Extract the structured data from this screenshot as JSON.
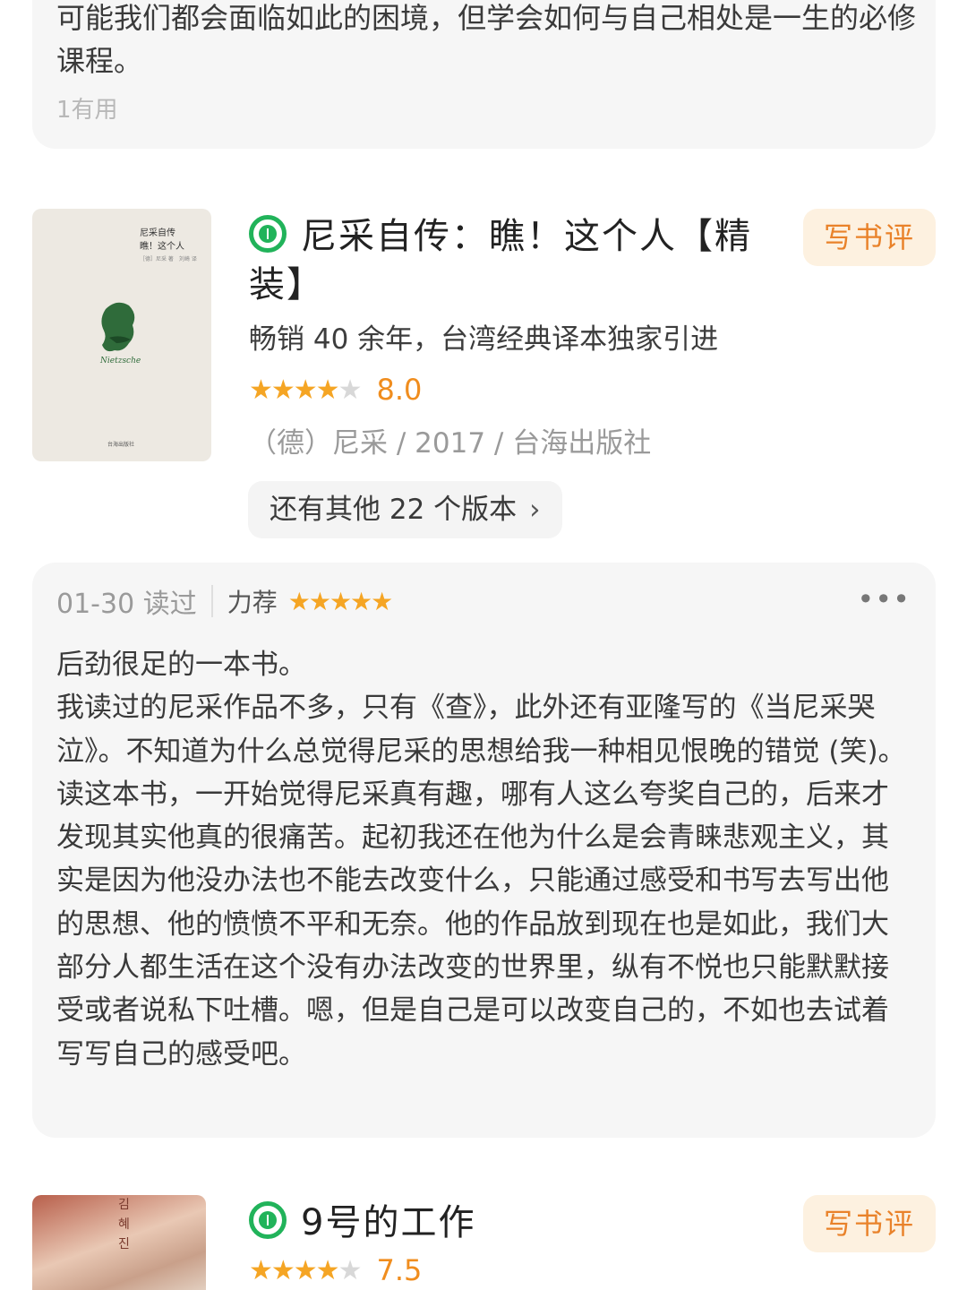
{
  "prev_review": {
    "text": "可能我们都会面临如此的困境，但学会如何与自己相处是一生的必修课程。",
    "useful": "1有用"
  },
  "book1": {
    "title": "尼采自传：瞧！这个人【精装】",
    "subtitle": "畅销 40 余年，台湾经典译本独家引进",
    "stars": "★★★★",
    "stars_off": "★",
    "score": "8.0",
    "meta": "（德）尼采 / 2017 / 台海出版社",
    "write_label": "写书评",
    "versions_label": "还有其他 22 个版本",
    "versions_chevron": "›",
    "cover_title_1": "尼采自传",
    "cover_title_2": "瞧！这个人",
    "cover_small": "［德］尼采 著　刘崎 译",
    "cover_publisher": "台海出版社",
    "cover_signature": "Nietzsche",
    "icon": "reading-book-icon"
  },
  "review": {
    "date": "01-30 读过",
    "recommend": "力荐",
    "stars": "★★★★★",
    "more": "•••",
    "body": "后劲很足的一本书。\n我读过的尼采作品不多，只有《查》，此外还有亚隆写的《当尼采哭泣》。不知道为什么总觉得尼采的思想给我一种相见恨晚的错觉 (笑)。\n读这本书，一开始觉得尼采真有趣，哪有人这么夸奖自己的，后来才发现其实他真的很痛苦。起初我还在他为什么是会青睐悲观主义，其实是因为他没办法也不能去改变什么，只能通过感受和书写去写出他的思想、他的愤愤不平和无奈。他的作品放到现在也是如此，我们大部分人都生活在这个没有办法改变的世界里，纵有不悦也只能默默接受或者说私下吐槽。嗯，但是自己是可以改变自己的，不如也去试着写写自己的感受吧。"
  },
  "book2": {
    "title": "9号的工作",
    "stars": "★★★★",
    "stars_off": "★",
    "score": "7.5",
    "write_label": "写书评",
    "cover_text": "김혜진"
  },
  "colors": {
    "accent_green": "#21b35a",
    "star_orange": "#f5a524",
    "score_orange": "#f08d1e",
    "write_button_bg": "#fdf1e0"
  }
}
